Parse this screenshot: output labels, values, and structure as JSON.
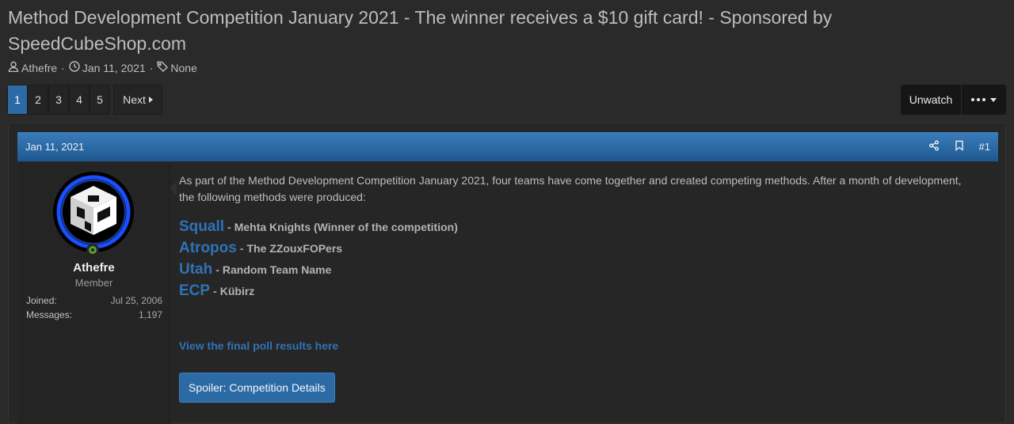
{
  "thread": {
    "title": "Method Development Competition January 2021 - The winner receives a $10 gift card! - Sponsored by SpeedCubeShop.com",
    "author": "Athefre",
    "date": "Jan 11, 2021",
    "tags": "None"
  },
  "pagination": {
    "pages": [
      "1",
      "2",
      "3",
      "4",
      "5"
    ],
    "current": "1",
    "next_label": "Next"
  },
  "toolbar": {
    "unwatch_label": "Unwatch",
    "more_icon": "ellipsis-icon"
  },
  "post": {
    "date": "Jan 11, 2021",
    "number": "#1",
    "user": {
      "name": "Athefre",
      "title": "Member",
      "joined_label": "Joined:",
      "joined_value": "Jul 25, 2006",
      "messages_label": "Messages:",
      "messages_value": "1,197"
    },
    "intro": "As part of the Method Development Competition January 2021, four teams have come together and created competing methods. After a month of development, the following methods were produced:",
    "methods": [
      {
        "name": "Squall",
        "team": "Mehta Knights (Winner of the competition)"
      },
      {
        "name": "Atropos",
        "team": "The ZZouxFOPers"
      },
      {
        "name": "Utah",
        "team": "Random Team Name"
      },
      {
        "name": "ECP",
        "team": "Kübirz"
      }
    ],
    "dash": "-",
    "poll_link": "View the final poll results here",
    "spoiler_label": "Spoiler: Competition Details"
  },
  "colors": {
    "accent": "#2c6aa6",
    "link": "#2f73b7",
    "online": "#5aa02c",
    "background": "#2a2a2a"
  }
}
